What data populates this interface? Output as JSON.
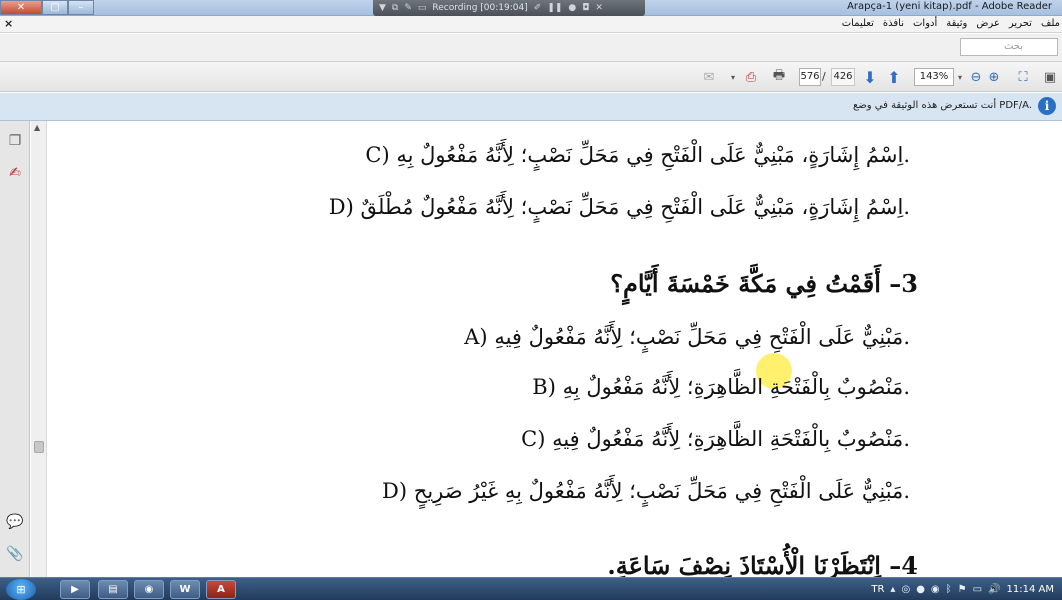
{
  "window": {
    "title": "Arapça-1 (yeni kitap).pdf - Adobe Reader",
    "recording_label": "Recording [00:19:04]"
  },
  "menu": {
    "close_glyph": "×",
    "items": [
      "ملف",
      "تحرير",
      "عرض",
      "وثيقة",
      "أدوات",
      "نافذة",
      "تعليمات"
    ]
  },
  "search": {
    "placeholder": "بحث"
  },
  "toolbar": {
    "current_page": "576",
    "page_separator": "/",
    "total_pages": "426",
    "zoom": "143%"
  },
  "infobar": {
    "text": "أنت تستعرض هذه الوثيقة في وضع PDF/A.",
    "icon": "i"
  },
  "document": {
    "lines": [
      {
        "id": "opt-c-prev",
        "text": "C) اِسْمُ إِشَارَةٍ، مَبْنِيٌّ عَلَى الْفَتْحِ فِي مَحَلِّ نَصْبٍ؛ لِأَنَّهُ مَفْعُولٌ بِهِ."
      },
      {
        "id": "opt-d-prev",
        "text": "D) اِسْمُ إِشَارَةٍ، مَبْنِيٌّ عَلَى الْفَتْحِ فِي مَحَلِّ نَصْبٍ؛ لِأَنَّهُ مَفْعُولٌ مُطْلَقٌ."
      },
      {
        "id": "question-3",
        "text": "3– أَقَمْتُ فِي مَكَّةَ خَمْسَةَ أَيَّامٍ؟"
      },
      {
        "id": "opt-a",
        "text": "A) مَبْنِيٌّ عَلَى الْفَتْحِ فِي مَحَلِّ نَصْبٍ؛ لِأَنَّهُ مَفْعُولٌ فِيهِ."
      },
      {
        "id": "opt-b",
        "text": "B) مَنْصُوبٌ بِالْفَتْحَةِ الظَّاهِرَةِ؛ لِأَنَّهُ مَفْعُولٌ بِهِ."
      },
      {
        "id": "opt-c",
        "text": "C) مَنْصُوبٌ بِالْفَتْحَةِ الظَّاهِرَةِ؛ لِأَنَّهُ مَفْعُولٌ فِيهِ."
      },
      {
        "id": "opt-d",
        "text": "D) مَبْنِيٌّ عَلَى الْفَتْحِ فِي مَحَلِّ نَصْبٍ؛ لِأَنَّهُ مَفْعُولٌ بِهِ غَيْرُ صَرِيحٍ."
      },
      {
        "id": "question-4",
        "text": "4– اِنْتَظَرْنَا الْأُسْتَاذَ نِصْفَ سَاعَةٍ."
      }
    ]
  },
  "taskbar": {
    "start_label": "⊞",
    "apps": [
      "▶",
      "▤",
      "◉",
      "W",
      "A"
    ],
    "language": "TR",
    "clock": "11:14 AM"
  },
  "colors": {
    "infobar_bg": "#d7e5f3",
    "taskbar_bg": "#223b5c",
    "highlight": "#ffeb3c"
  }
}
